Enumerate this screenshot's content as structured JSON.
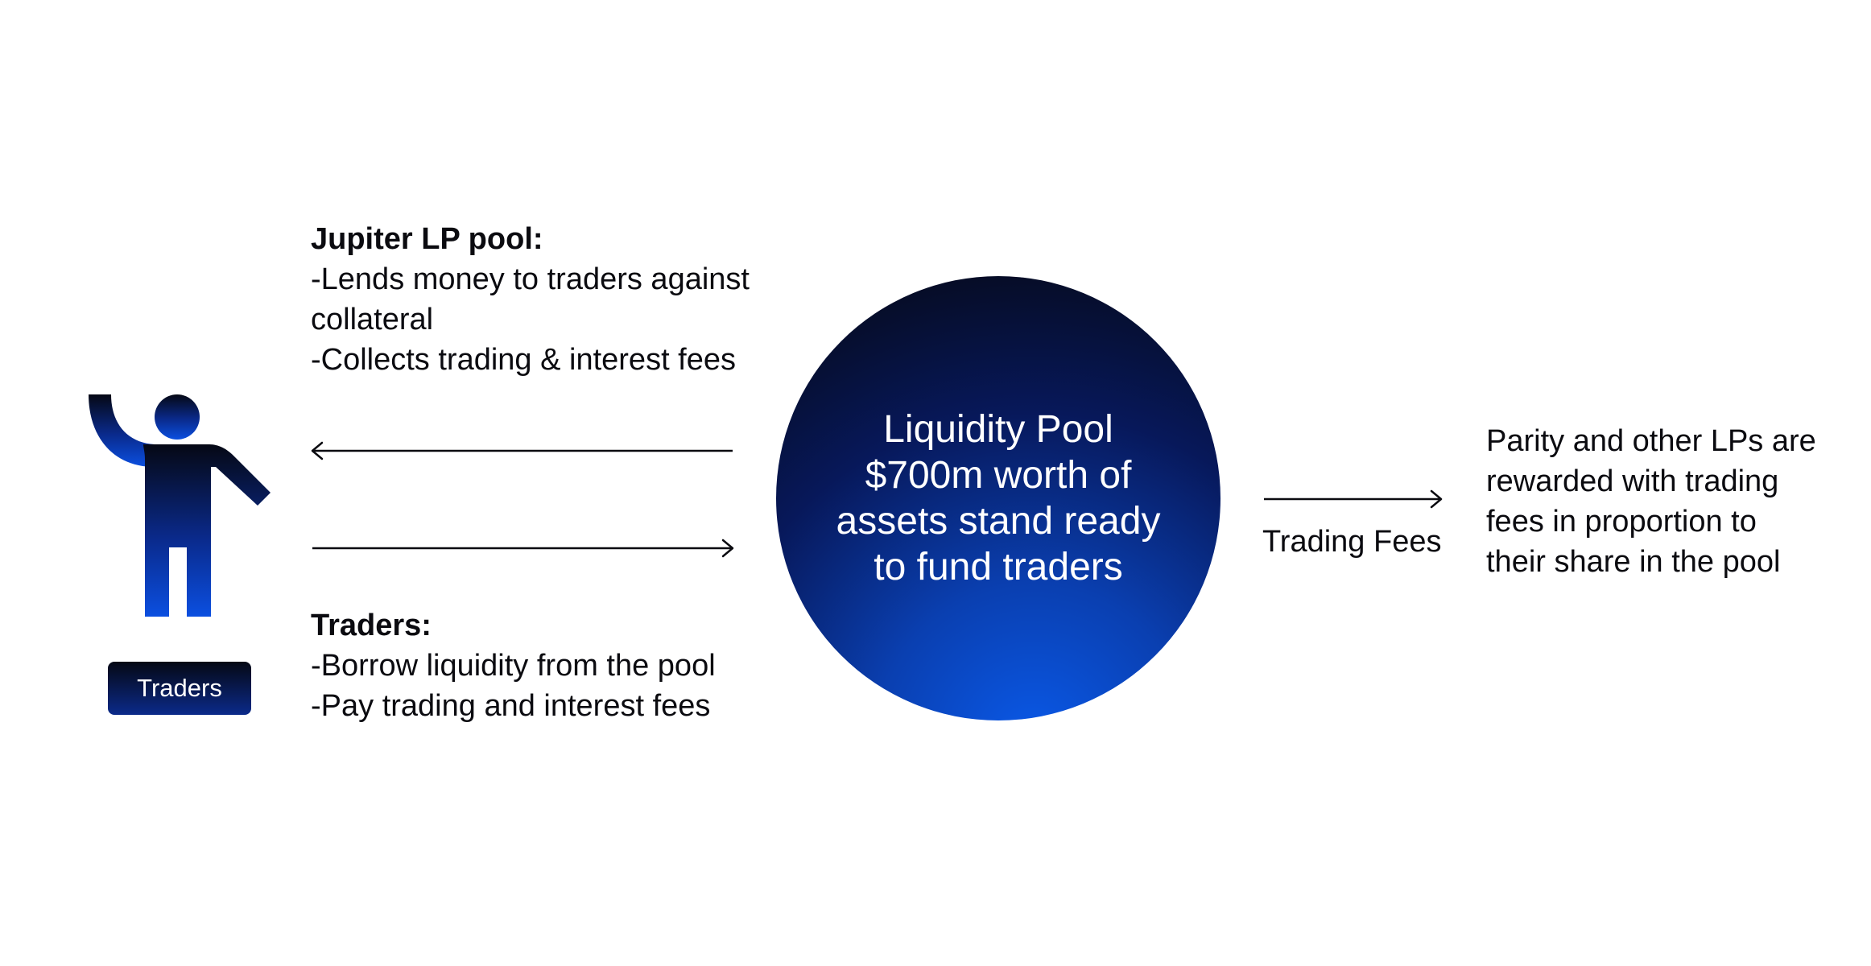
{
  "trader": {
    "badge_label": "Traders"
  },
  "jupiter_pool": {
    "heading": "Jupiter LP pool:",
    "lines": [
      "-Lends money to traders against",
      "collateral",
      "-Collects trading & interest fees"
    ]
  },
  "traders_info": {
    "heading": "Traders:",
    "lines": [
      "-Borrow liquidity from the pool",
      "-Pay trading and interest fees"
    ]
  },
  "liquidity_pool": {
    "lines": [
      "Liquidity Pool",
      "$700m worth of",
      "assets stand ready",
      "to fund traders"
    ]
  },
  "trading_fees_label": "Trading Fees",
  "lp_rewards": {
    "lines": [
      "Parity and other LPs are",
      "rewarded with trading",
      "fees in proportion to",
      "their share in the pool"
    ]
  },
  "colors": {
    "dark": "#05070f",
    "blue": "#0a59e8",
    "text": "#0b0b10"
  },
  "icons": {
    "trader": "person-waving-icon",
    "arrow_left": "arrow-left-icon",
    "arrow_right": "arrow-right-icon"
  }
}
